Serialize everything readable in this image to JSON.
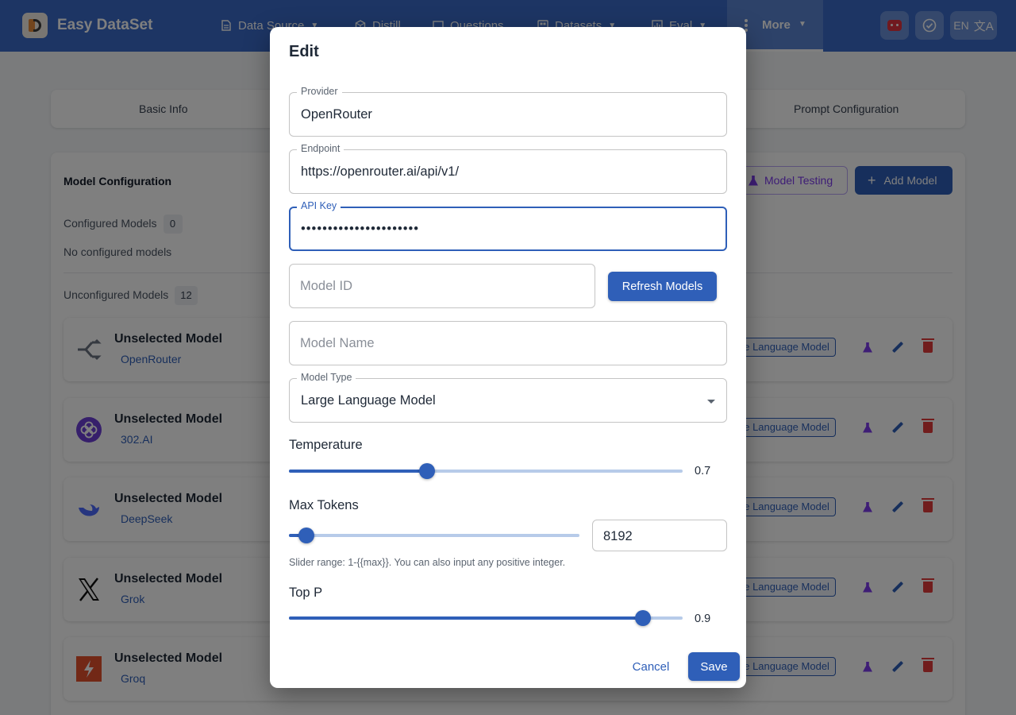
{
  "app": {
    "title": "Easy DataSet"
  },
  "nav": {
    "items": [
      {
        "label": "Data Source",
        "icon": "file-icon",
        "has_caret": true
      },
      {
        "label": "Distill",
        "icon": "cube-icon",
        "has_caret": false
      },
      {
        "label": "Questions",
        "icon": "question-board-icon",
        "has_caret": false
      },
      {
        "label": "Datasets",
        "icon": "dataset-icon",
        "has_caret": true
      },
      {
        "label": "Eval",
        "icon": "chart-icon",
        "has_caret": true
      }
    ],
    "more": {
      "label": "More",
      "icon": "more-vertical-icon"
    }
  },
  "header_actions": {
    "lang": "EN",
    "lang_icon": "translate-icon",
    "robot_icon": "robot-icon",
    "check_icon": "check-circle-icon"
  },
  "page_tabs": [
    "Basic Info",
    "Prompt Configuration"
  ],
  "model_config": {
    "title": "Model Configuration",
    "test_button": "Model Testing",
    "add_button": "Add Model",
    "configured_label": "Configured Models",
    "configured_count": "0",
    "empty_text": "No configured models",
    "unconfigured_label": "Unconfigured Models",
    "unconfigured_count": "12",
    "models": [
      {
        "name": "Unselected Model",
        "provider": "OpenRouter",
        "type_chip": "ge Language Model",
        "icon": "openrouter-logo-icon"
      },
      {
        "name": "Unselected Model",
        "provider": "302.AI",
        "type_chip": "ge Language Model",
        "icon": "302ai-logo-icon"
      },
      {
        "name": "Unselected Model",
        "provider": "DeepSeek",
        "type_chip": "ge Language Model",
        "icon": "deepseek-whale-icon"
      },
      {
        "name": "Unselected Model",
        "provider": "Grok",
        "type_chip": "ge Language Model",
        "icon": "x-logo-icon"
      },
      {
        "name": "Unselected Model",
        "provider": "Groq",
        "type_chip": "ge Language Model",
        "icon": "groq-bolt-icon"
      }
    ]
  },
  "dialog": {
    "title": "Edit",
    "provider": {
      "label": "Provider",
      "value": "OpenRouter"
    },
    "endpoint": {
      "label": "Endpoint",
      "value": "https://openrouter.ai/api/v1/"
    },
    "api_key": {
      "label": "API Key",
      "value": "••••••••••••••••••••••"
    },
    "model_id": {
      "placeholder": "Model ID",
      "value": ""
    },
    "refresh_button": "Refresh Models",
    "model_name": {
      "placeholder": "Model Name",
      "value": ""
    },
    "model_type": {
      "label": "Model Type",
      "value": "Large Language Model"
    },
    "temperature": {
      "label": "Temperature",
      "value": "0.7",
      "fraction": 0.35
    },
    "max_tokens": {
      "label": "Max Tokens",
      "value": "8192",
      "fraction": 0.06
    },
    "hint": "Slider range: 1-{{max}}. You can also input any positive integer.",
    "top_p": {
      "label": "Top P",
      "value": "0.9",
      "fraction": 0.9
    },
    "cancel": "Cancel",
    "save": "Save"
  },
  "colors": {
    "appbar": "#3a6bc8",
    "primary": "#2f5fb8",
    "accent_purple": "#7c3aed",
    "danger": "#e23b3b"
  }
}
